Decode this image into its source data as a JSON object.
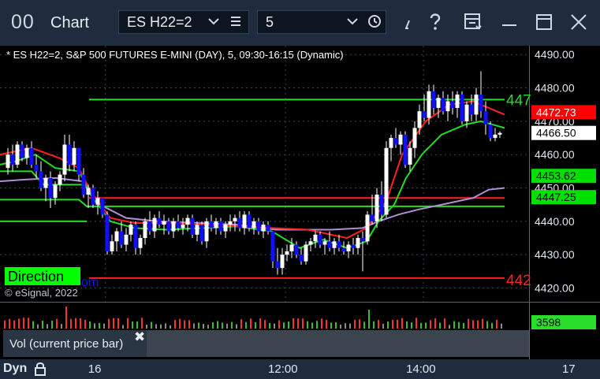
{
  "window": {
    "logo": "00",
    "title": "Chart",
    "symbol_value": "ES H22=2",
    "interval_value": "5"
  },
  "chart": {
    "header": "* ES H22=2, S&P 500 FUTURES E-MINI (DAY), 5, 09:30-16:15 (Dynamic)",
    "copyright": "© eSignal, 2022",
    "direction_label": "Direction",
    "direction_suffix": "om",
    "y_ticks": [
      "4490.00",
      "4480.00",
      "4470.00",
      "4460.00",
      "4450.00",
      "4440.00",
      "4430.00",
      "4420.00"
    ],
    "y_range": [
      4418,
      4491
    ],
    "price_tags": [
      {
        "value": "4472.73",
        "num": 4472.73,
        "bg": "#ff0000",
        "fg": "#ffffff"
      },
      {
        "value": "4466.50",
        "num": 4466.5,
        "bg": "#ffffff",
        "fg": "#000000"
      },
      {
        "value": "4453.62",
        "num": 4453.62,
        "bg": "#00e000",
        "fg": "#000000"
      },
      {
        "value": "4447.25",
        "num": 4447.25,
        "bg": "#00e000",
        "fg": "#000000"
      }
    ],
    "right_edge_labels": [
      {
        "text": "447",
        "color": "#22dd22",
        "num": 4476.5
      },
      {
        "text": "442",
        "color": "#ff2222",
        "num": 4422.5
      }
    ]
  },
  "volume": {
    "legend": "Vol (current price bar)",
    "close_glyph": "✖",
    "tag": "3598"
  },
  "time_axis": {
    "mode": "Dyn",
    "labels": [
      {
        "text": "16",
        "at": 0.16
      },
      {
        "text": "12:00",
        "at": 0.46
      },
      {
        "text": "14:00",
        "at": 0.69
      },
      {
        "text": "17",
        "at": 0.95
      }
    ]
  },
  "colors": {
    "up": "#ffffff",
    "down": "#1010ff",
    "red_line": "#ff2020",
    "green_line": "#22dd22",
    "purple_line": "#b08fd6",
    "grid": "#3a4552"
  }
}
